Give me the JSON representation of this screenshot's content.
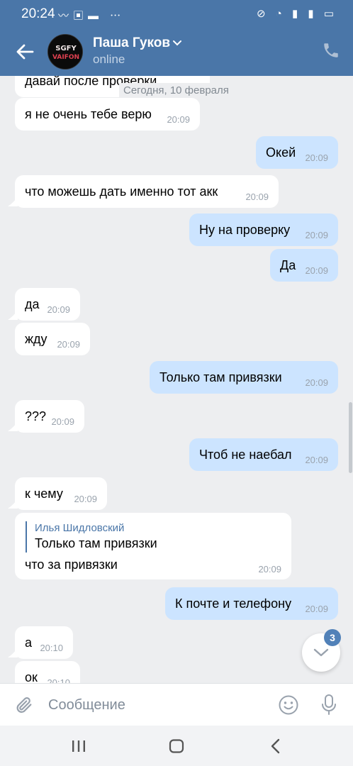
{
  "status_bar": {
    "time": "20:24"
  },
  "header": {
    "contact_name": "Паша Гуков",
    "status": "online",
    "avatar_text": "SGFY\nVAIFON"
  },
  "chat": {
    "date_separator": "Сегодня, 10 февраля",
    "partial_top": "давай после проверки",
    "messages": [
      {
        "dir": "in",
        "text": "я не очень тебе верю",
        "time": "20:09"
      },
      {
        "dir": "out",
        "text": "Окей",
        "time": "20:09"
      },
      {
        "dir": "in",
        "text": "что можешь дать именно тот акк",
        "time": "20:09"
      },
      {
        "dir": "out",
        "text": "Ну на проверку",
        "time": "20:09"
      },
      {
        "dir": "out",
        "text": "Да",
        "time": "20:09"
      },
      {
        "dir": "in",
        "text": "да",
        "time": "20:09"
      },
      {
        "dir": "in",
        "text": "жду",
        "time": "20:09"
      },
      {
        "dir": "out",
        "text": "Только там привязки",
        "time": "20:09"
      },
      {
        "dir": "in",
        "text": "???",
        "time": "20:09"
      },
      {
        "dir": "out",
        "text": "Чтоб не наебал",
        "time": "20:09"
      },
      {
        "dir": "in",
        "text": "к чему",
        "time": "20:09"
      },
      {
        "dir": "in",
        "reply_author": "Илья Шидловский",
        "reply_text": "Только там привязки",
        "text": "что за привязки",
        "time": "20:09"
      },
      {
        "dir": "out",
        "text": "К почте и телефону",
        "time": "20:09"
      },
      {
        "dir": "in",
        "text": "а",
        "time": "20:10"
      },
      {
        "dir": "in",
        "text": "ок",
        "time": "20:10"
      }
    ],
    "unread_badge": "3"
  },
  "composer": {
    "placeholder": "Сообщение"
  }
}
